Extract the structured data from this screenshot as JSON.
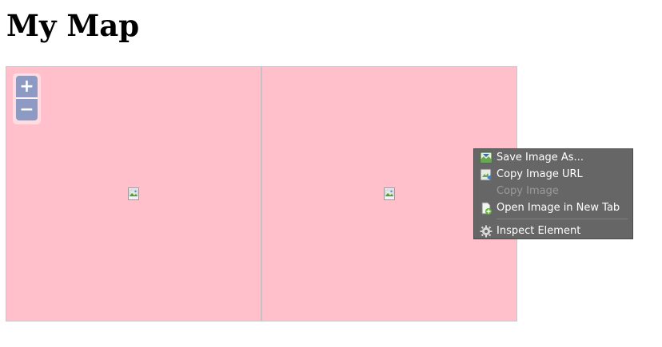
{
  "page": {
    "title": "My Map"
  },
  "map": {
    "background": "#ffc0cb",
    "zoom": {
      "in_label": "+",
      "out_label": "−",
      "button_color": "#8d9ac3"
    }
  },
  "context_menu": {
    "background": "#666666",
    "items": [
      {
        "label": "Save Image As...",
        "icon": "save-image-icon",
        "enabled": true
      },
      {
        "label": "Copy Image URL",
        "icon": "copy-link-icon",
        "enabled": true
      },
      {
        "label": "Copy Image",
        "icon": "",
        "enabled": false
      },
      {
        "label": "Open Image in New Tab",
        "icon": "new-tab-icon",
        "enabled": true
      },
      {
        "label": "Inspect Element",
        "icon": "gear-icon",
        "enabled": true
      }
    ]
  }
}
